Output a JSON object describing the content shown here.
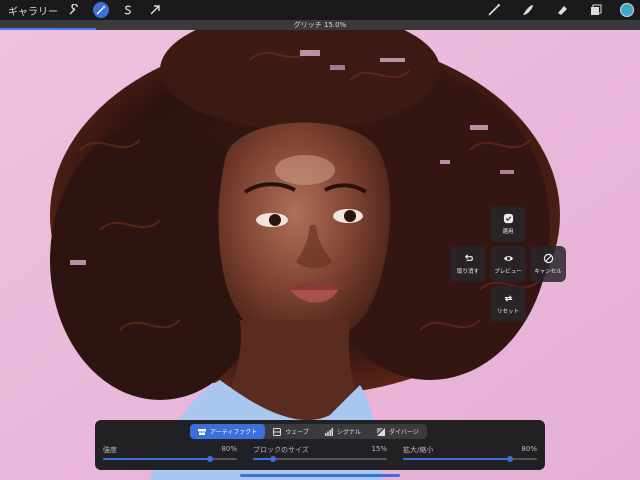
{
  "toolbar": {
    "gallery_label": "ギャラリー",
    "tools_left": [
      {
        "name": "wrench-icon",
        "active": false
      },
      {
        "name": "magic-wand-icon",
        "active": true
      },
      {
        "name": "selection-s-icon",
        "active": false
      },
      {
        "name": "transform-arrow-icon",
        "active": false
      }
    ],
    "tools_right": [
      "brush-icon",
      "smudge-icon",
      "eraser-icon",
      "layers-icon"
    ],
    "current_color": "#3fa8c9"
  },
  "status": {
    "text": "グリッチ 15.0%",
    "progress_fraction": 0.15
  },
  "effect_controls": {
    "apply_label": "適用",
    "undo_label": "取り消す",
    "preview_label": "プレビュー",
    "cancel_label": "キャンセル",
    "reset_label": "リセット"
  },
  "panel": {
    "tabs": [
      {
        "label": "アーティファクト",
        "icon": "artifact-icon",
        "active": true
      },
      {
        "label": "ウェーブ",
        "icon": "wave-icon",
        "active": false
      },
      {
        "label": "シグナル",
        "icon": "signal-icon",
        "active": false
      },
      {
        "label": "ダイバージ",
        "icon": "diverge-icon",
        "active": false
      }
    ],
    "sliders": [
      {
        "label": "強度",
        "value_text": "80%",
        "value": 0.8
      },
      {
        "label": "ブロックのサイズ",
        "value_text": "15%",
        "value": 0.15
      },
      {
        "label": "拡大/縮小",
        "value_text": "80%",
        "value": 0.8
      }
    ]
  },
  "colors": {
    "accent": "#3a6fdc",
    "background_pink": "#e8b8d8"
  }
}
